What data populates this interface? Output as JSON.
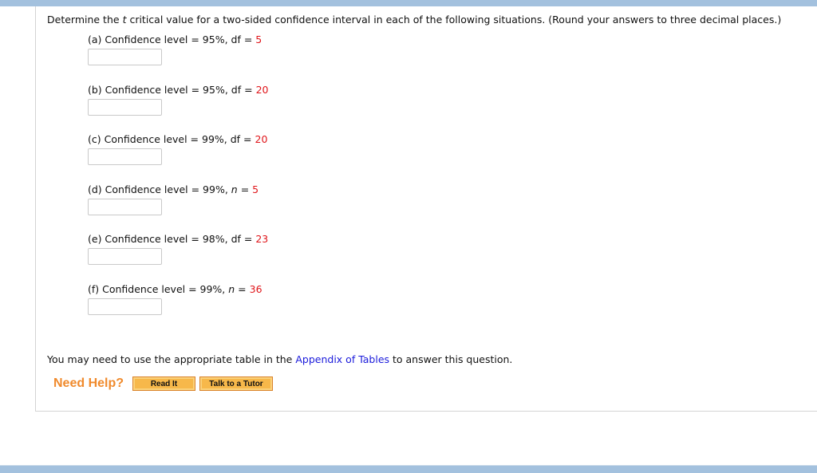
{
  "intro": {
    "pre": "Determine the ",
    "t": "t",
    "post": " critical value for a two-sided confidence interval in each of the following situations. (Round your answers to three decimal places.)"
  },
  "questions": [
    {
      "label": "(a) Confidence level = 95%, ",
      "var": "df",
      "eq": " = ",
      "value": "5",
      "answer": ""
    },
    {
      "label": "(b) Confidence level = 95%, ",
      "var": "df",
      "eq": " = ",
      "value": "20",
      "answer": ""
    },
    {
      "label": "(c) Confidence level = 99%, ",
      "var": "df",
      "eq": " = ",
      "value": "20",
      "answer": ""
    },
    {
      "label": "(d) Confidence level = 99%, ",
      "var": "n",
      "eq": " = ",
      "value": "5",
      "answer": ""
    },
    {
      "label": "(e) Confidence level = 98%, ",
      "var": "df",
      "eq": " = ",
      "value": "23",
      "answer": ""
    },
    {
      "label": "(f) Confidence level = 99%, ",
      "var": "n",
      "eq": " = ",
      "value": "36",
      "answer": ""
    }
  ],
  "note": {
    "pre": "You may need to use the appropriate table in the ",
    "link": "Appendix of Tables",
    "post": " to answer this question."
  },
  "help": {
    "label": "Need Help?",
    "read_it": "Read It",
    "tutor": "Talk to a Tutor"
  },
  "colors": {
    "given_value": "#e0161b",
    "link": "#1a1adb",
    "help": "#f08a2c",
    "button": "#f7b84a"
  }
}
